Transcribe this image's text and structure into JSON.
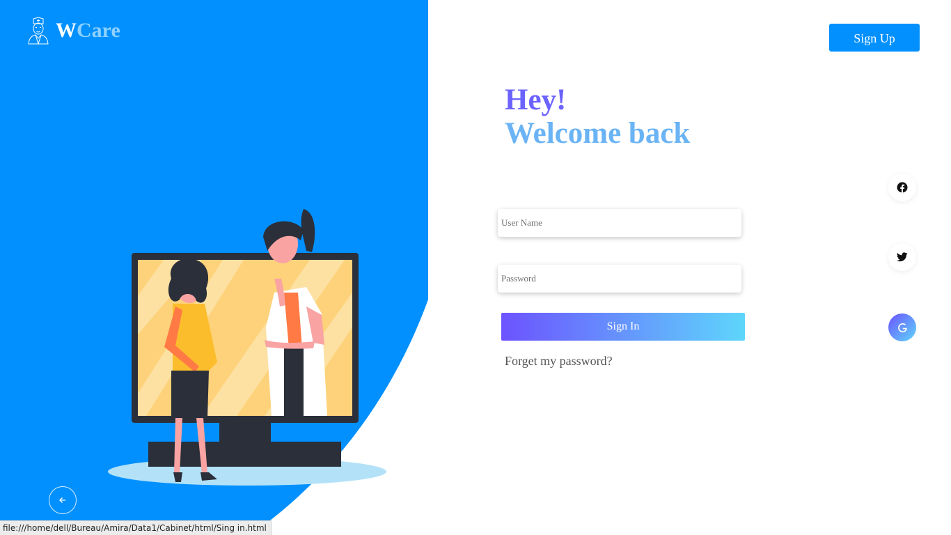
{
  "brand": {
    "name_first": "W",
    "name_rest": "Care"
  },
  "header": {
    "signup_label": "Sign Up"
  },
  "greeting": {
    "line1": "Hey!",
    "line2": "Welcome back"
  },
  "form": {
    "username_placeholder": "User Name",
    "username_value": "",
    "password_placeholder": "Password",
    "password_value": "",
    "signin_label": "Sign In",
    "forgot_label": "Forget my password?"
  },
  "social": [
    {
      "icon": "facebook-icon"
    },
    {
      "icon": "twitter-icon"
    },
    {
      "icon": "google-icon"
    }
  ],
  "status_bar": {
    "url": "file:///home/dell/Bureau/Amira/Data1/Cabinet/html/Sing in.html"
  },
  "colors": {
    "primary_blue": "#0290fe",
    "heading_purple": "#6c63ff",
    "heading_blue": "#6ab3f5",
    "gradient_start": "#6c53ff",
    "gradient_end": "#5ed6fb"
  }
}
